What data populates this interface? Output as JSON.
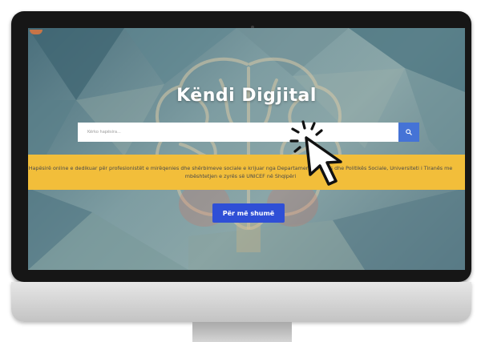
{
  "site": {
    "title": "Këndi Digjital"
  },
  "search": {
    "placeholder": "Kërko hapësira..."
  },
  "banner": {
    "text": "Hapësirë online e dedikuar për profesionistët e mirëqenies dhe shërbimeve sociale e krijuar nga Departamenti i Punës dhe Politikës Sociale, Universiteti i Tiranës me mbështetjen e zyrës së UNICEF në Shqipëri"
  },
  "cta": {
    "label": "Për më shumë"
  },
  "icons": {
    "search": "search-icon",
    "pointer": "hand-pointer-cursor-icon",
    "click": "click-burst-icon"
  },
  "colors": {
    "banner": "#f2be3a",
    "button": "#2f4fd6",
    "search_button": "#4573d6"
  }
}
